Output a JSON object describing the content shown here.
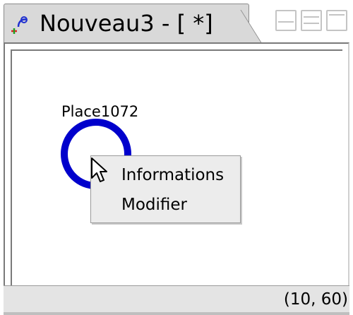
{
  "window": {
    "title": "Nouveau3 - [ *]",
    "app_icon": "petri-net-icon"
  },
  "window_controls": [
    {
      "name": "minimize-button",
      "icon": "minimize-icon"
    },
    {
      "name": "tile-button",
      "icon": "tile-icon"
    },
    {
      "name": "maximize-button",
      "icon": "maximize-icon"
    }
  ],
  "canvas": {
    "place": {
      "label": "Place1072",
      "color": "#0000cc"
    }
  },
  "context_menu": {
    "items": [
      {
        "label": "Informations"
      },
      {
        "label": "Modifier"
      }
    ]
  },
  "statusbar": {
    "coords": "(10, 60)"
  }
}
